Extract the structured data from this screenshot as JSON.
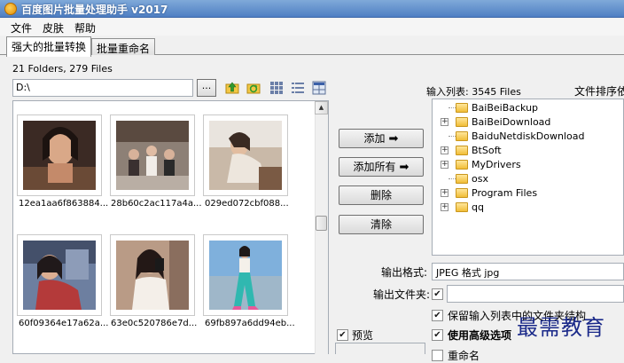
{
  "window": {
    "title": "百度图片批量处理助手 v2017",
    "icon": "app-logo-icon"
  },
  "menu": [
    "文件",
    "皮肤",
    "帮助"
  ],
  "tabs": [
    {
      "label": "强大的批量转换",
      "active": true
    },
    {
      "label": "批量重命名",
      "active": false
    }
  ],
  "browser": {
    "folder_count": "21 Folders, 279 Files",
    "path": "D:\\",
    "browse_label": "...",
    "toolbar_icons": [
      "up-folder-icon",
      "refresh-icon",
      "thumbnail-view-icon",
      "detail-view-icon",
      "grid-view-icon"
    ],
    "thumbnails": [
      {
        "label": "12ea1aa6f863884..."
      },
      {
        "label": "28b60c2ac117a4a..."
      },
      {
        "label": "029ed072cbf088..."
      },
      {
        "label": "60f09364e17a62a..."
      },
      {
        "label": "63e0c520786e7d..."
      },
      {
        "label": "69fb897a6dd94eb..."
      }
    ]
  },
  "actions": {
    "add": "添加",
    "add_all": "添加所有",
    "delete": "删除",
    "clear": "清除"
  },
  "input_list": {
    "label": "输入列表:",
    "count": "3545 Files",
    "sort_label": "文件排序依",
    "folders": [
      {
        "name": "BaiBeiBackup",
        "expandable": false
      },
      {
        "name": "BaiBeiDownload",
        "expandable": true
      },
      {
        "name": "BaiduNetdiskDownload",
        "expandable": false
      },
      {
        "name": "BtSoft",
        "expandable": true
      },
      {
        "name": "MyDrivers",
        "expandable": true
      },
      {
        "name": "osx",
        "expandable": false
      },
      {
        "name": "Program Files",
        "expandable": true
      },
      {
        "name": "qq",
        "expandable": true
      }
    ]
  },
  "output": {
    "format_label": "输出格式:",
    "format_value": "JPEG 格式 jpg",
    "folder_label": "输出文件夹:",
    "folder_checked": true,
    "folder_value": "",
    "keep_structure_label": "保留输入列表中的文件夹结构",
    "keep_structure_checked": true,
    "advanced_label": "使用高级选项",
    "advanced_checked": true,
    "rename_label": "重命名",
    "rename_checked": false
  },
  "preview": {
    "label": "预览",
    "checked": true
  },
  "watermark": "最需教育"
}
